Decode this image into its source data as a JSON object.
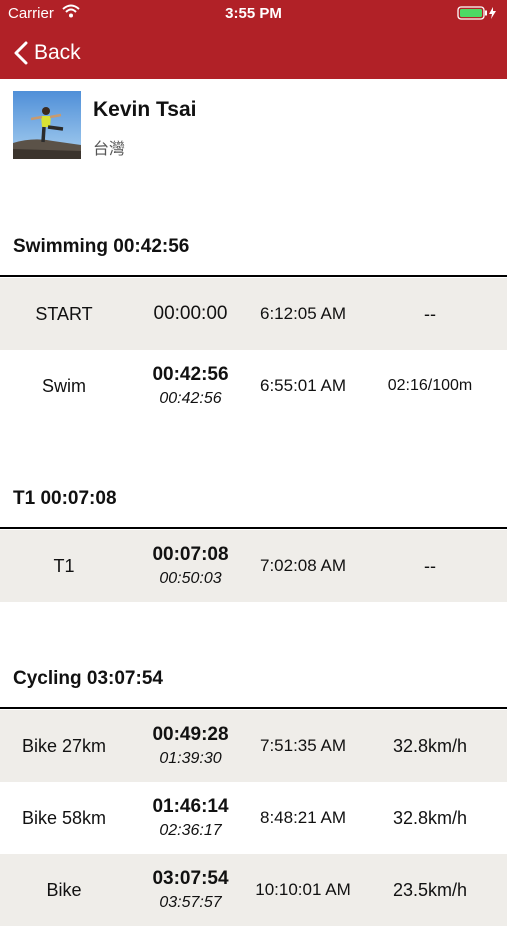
{
  "status_bar": {
    "carrier": "Carrier",
    "time": "3:55 PM"
  },
  "nav": {
    "back_label": "Back"
  },
  "athlete": {
    "name": "Kevin Tsai",
    "country": "台灣"
  },
  "sections": {
    "swimming": {
      "title": "Swimming 00:42:56",
      "rows": [
        {
          "label": "START",
          "split": "00:00:00",
          "cumulative": "",
          "clock": "6:12:05 AM",
          "pace": "--"
        },
        {
          "label": "Swim",
          "split": "00:42:56",
          "cumulative": "00:42:56",
          "clock": "6:55:01 AM",
          "pace": "02:16/100m"
        }
      ]
    },
    "t1": {
      "title": "T1 00:07:08",
      "rows": [
        {
          "label": "T1",
          "split": "00:07:08",
          "cumulative": "00:50:03",
          "clock": "7:02:08 AM",
          "pace": "--"
        }
      ]
    },
    "cycling": {
      "title": "Cycling 03:07:54",
      "rows": [
        {
          "label": "Bike 27km",
          "split": "00:49:28",
          "cumulative": "01:39:30",
          "clock": "7:51:35 AM",
          "pace": "32.8km/h"
        },
        {
          "label": "Bike 58km",
          "split": "01:46:14",
          "cumulative": "02:36:17",
          "clock": "8:48:21 AM",
          "pace": "32.8km/h"
        },
        {
          "label": "Bike",
          "split": "03:07:54",
          "cumulative": "03:57:57",
          "clock": "10:10:01 AM",
          "pace": "23.5km/h"
        }
      ]
    }
  },
  "colors": {
    "brand_red": "#b12127",
    "row_shade": "#efede9"
  },
  "icons": [
    "wifi-icon",
    "battery-icon",
    "charging-icon",
    "back-chevron-icon"
  ]
}
